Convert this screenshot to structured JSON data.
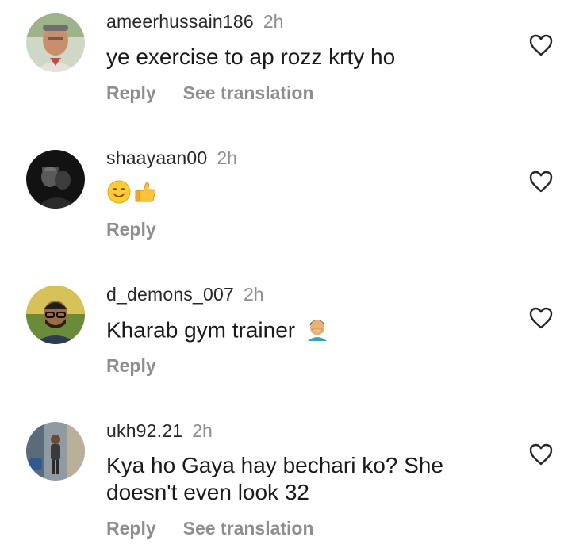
{
  "comments": [
    {
      "username": "ameerhussain186",
      "time": "2h",
      "text": "ye exercise to ap rozz krty ho",
      "reply_label": "Reply",
      "translate_label": "See translation"
    },
    {
      "username": "shaayaan00",
      "time": "2h",
      "text": "",
      "emojis": [
        "smiling-face-icon",
        "thumbs-up-icon"
      ],
      "reply_label": "Reply"
    },
    {
      "username": "d_demons_007",
      "time": "2h",
      "text": "Kharab gym trainer",
      "emojis": [
        "man-facepalming-icon"
      ],
      "reply_label": "Reply"
    },
    {
      "username": "ukh92.21",
      "time": "2h",
      "text_line1": "Kya ho Gaya hay bechari ko? She",
      "text_line2": "doesn't even look 32",
      "reply_label": "Reply",
      "translate_label": "See translation"
    }
  ],
  "colors": {
    "username": "#262626",
    "muted": "#8e8e8e",
    "text": "#1a1a1a",
    "heart_stroke": "#262626"
  }
}
